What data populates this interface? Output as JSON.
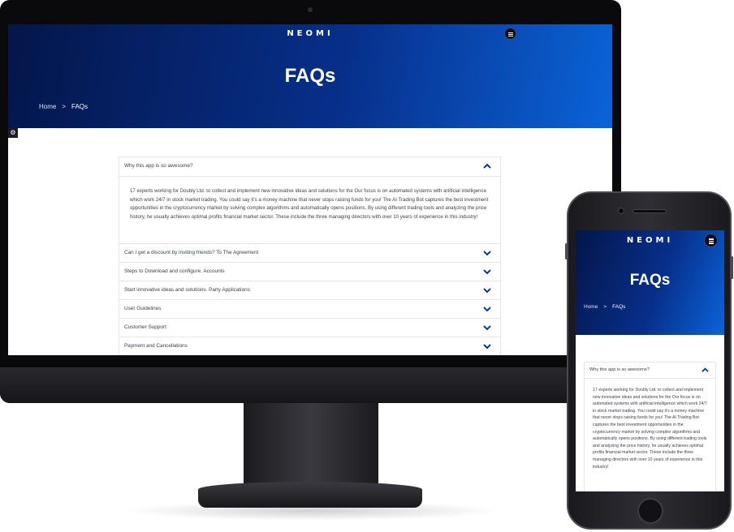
{
  "brand": {
    "logo": "NEOMI",
    "accent": "#0b3a8f",
    "hero_gradient": [
      "#04164a",
      "#0b63d8"
    ]
  },
  "page": {
    "title": "FAQs"
  },
  "breadcrumb": {
    "home": "Home",
    "separator": ">",
    "current": "FAQs"
  },
  "icons": {
    "menu": "hamburger-icon",
    "settings": "gear-icon",
    "open": "chevron-up-icon",
    "closed": "chevron-down-icon"
  },
  "faq": {
    "items": [
      {
        "question": "Why this app is so awesome?",
        "open": true,
        "answer": "17 experts working for Doubly Ltd. to collect and implement new innovative ideas and solutions for the Our focus is on automated systems with artificial intelligence which work 24/7 in stock market trading. You could say it's a money machine that never stops raising funds for you! The AI Trading Bot captures the best investment opportunities in the cryptocurrency market by solving complex algorithms and automatically opens positions. By using different trading tools and analyzing the price history, he usually achieves optimal profits financial market sector. These include the three managing directors with over 10 years of experience in this industry!"
      },
      {
        "question": "Can I get a discount by inviting friends? To The Agreement",
        "open": false
      },
      {
        "question": "Steps to Download and configure. Accounts",
        "open": false
      },
      {
        "question": "Start innovative ideas and solutions. Party Applications",
        "open": false
      },
      {
        "question": "User Guidelines",
        "open": false
      },
      {
        "question": "Customer Support",
        "open": false
      },
      {
        "question": "Payment and Cancellations",
        "open": false
      }
    ]
  }
}
